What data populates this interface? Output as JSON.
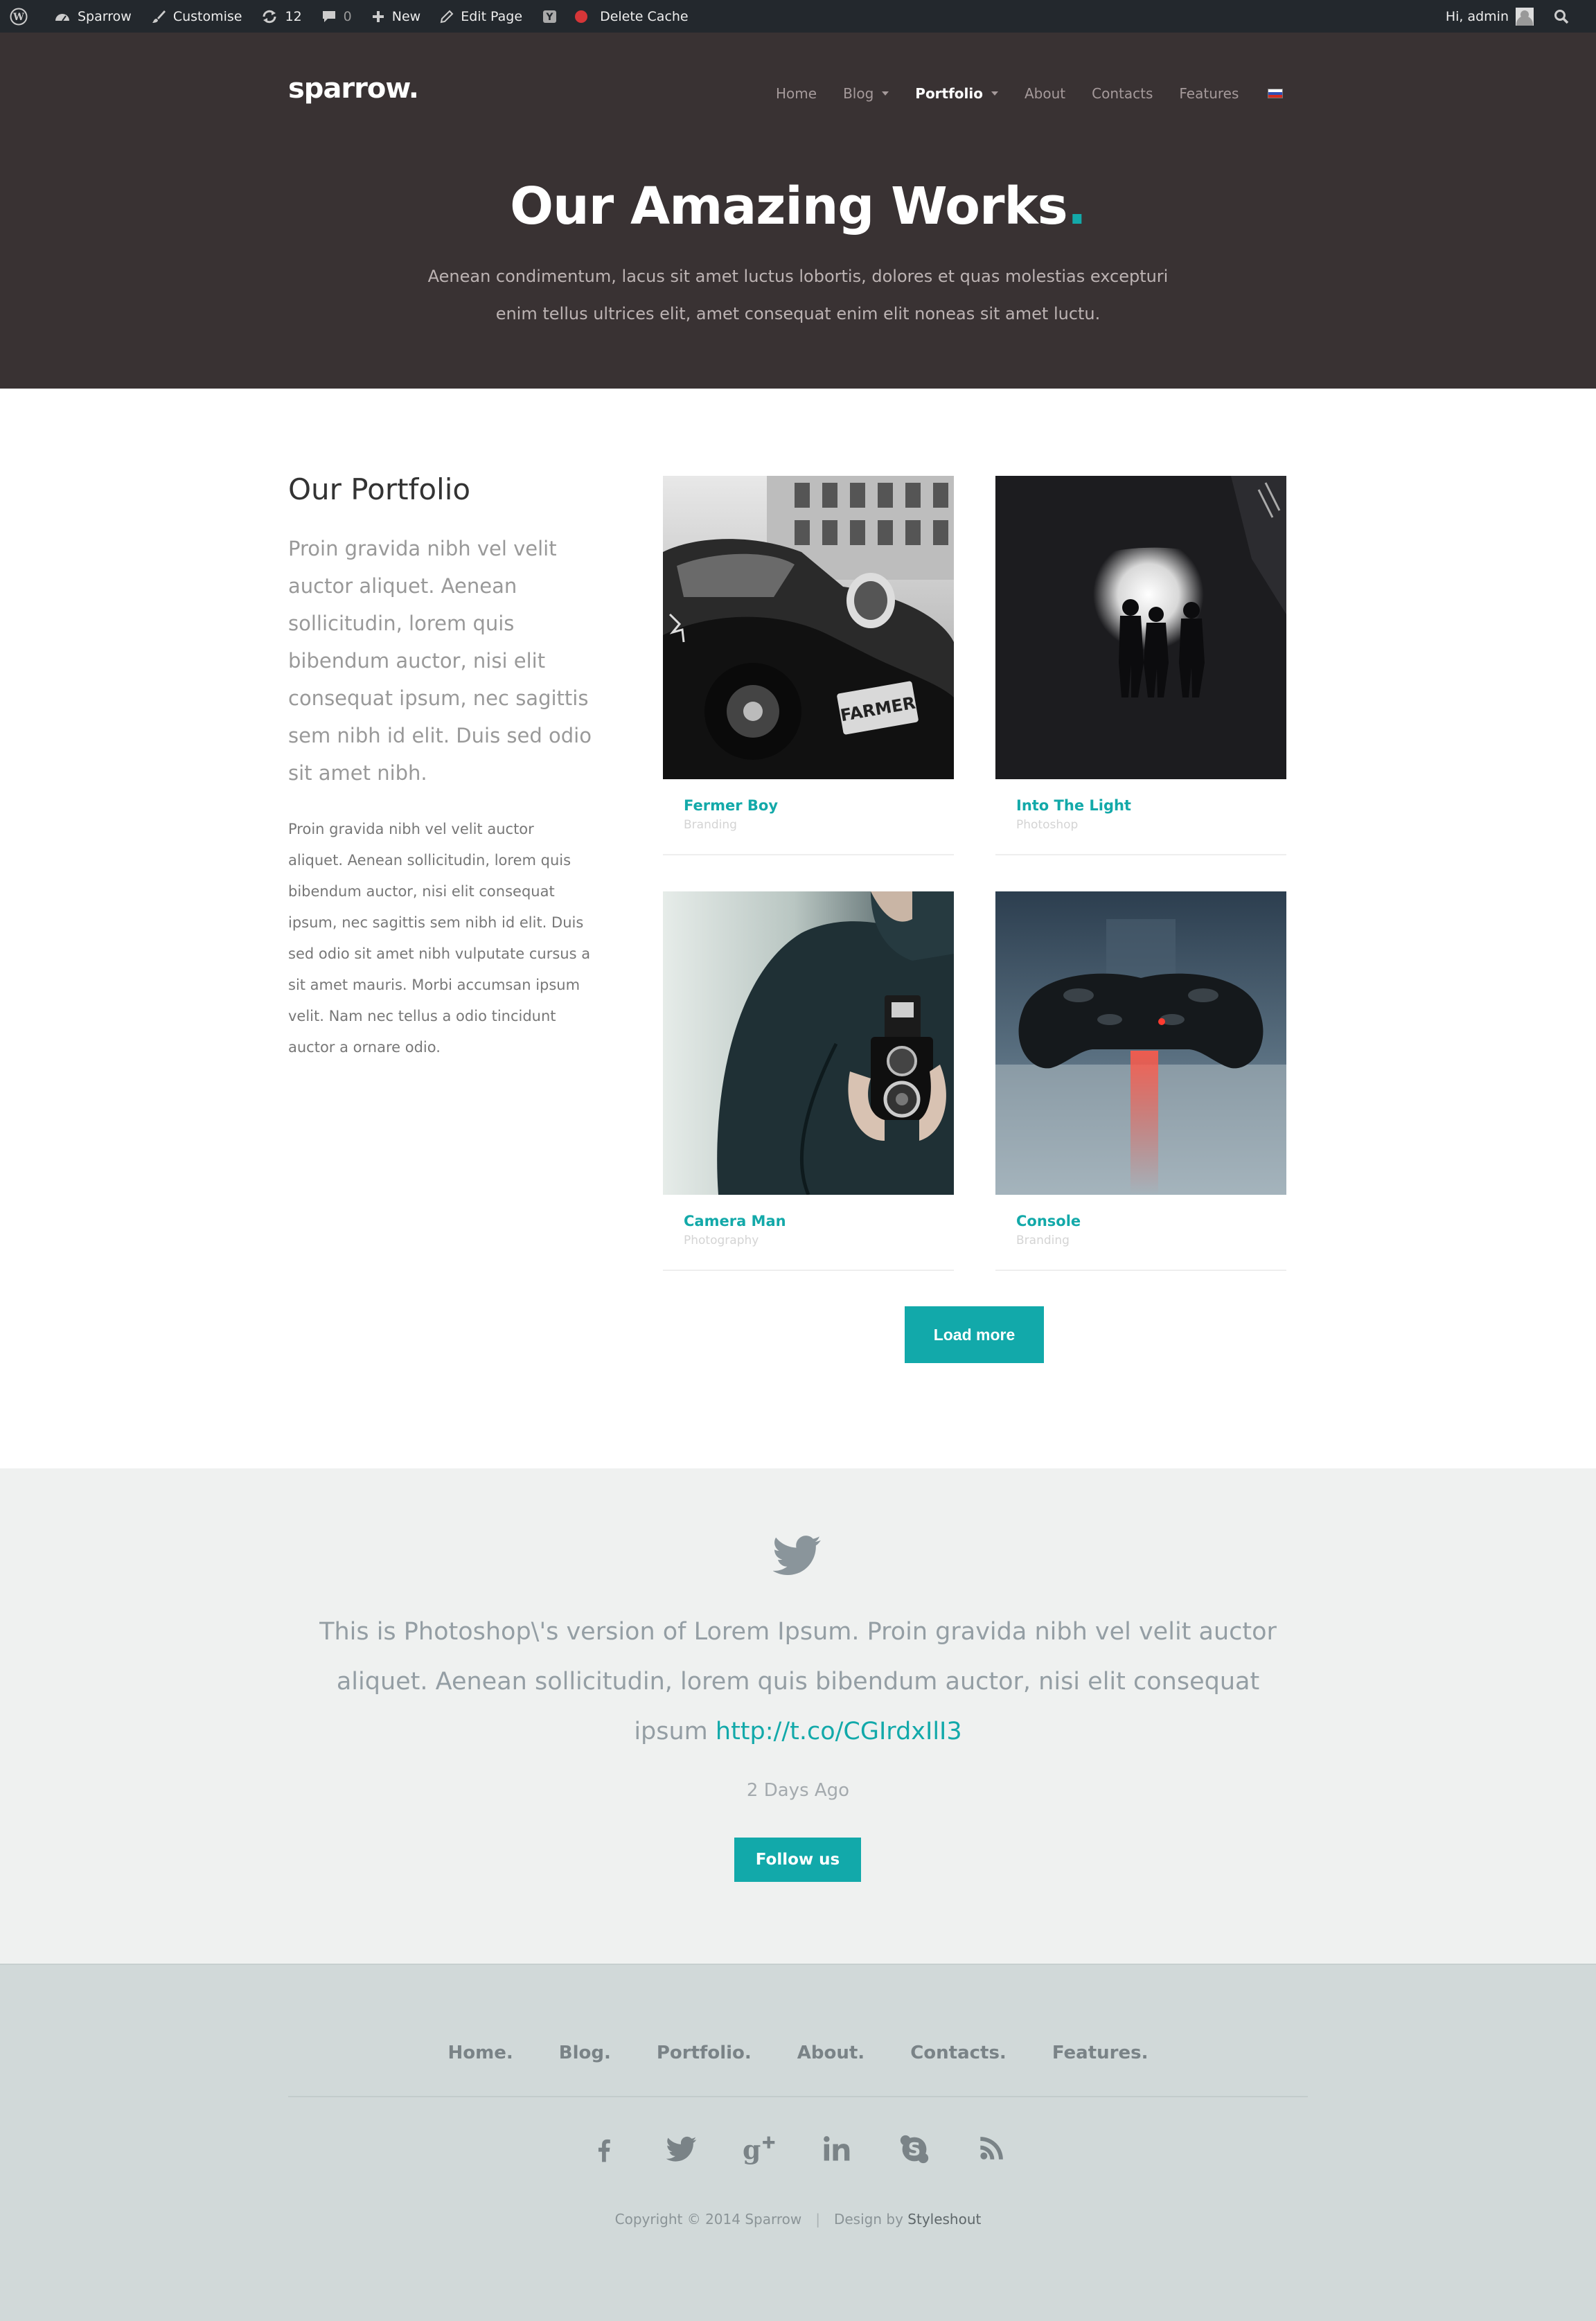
{
  "admin_bar": {
    "site_name": "Sparrow",
    "customise": "Customise",
    "updates": "12",
    "comments": "0",
    "new": "New",
    "edit_page": "Edit Page",
    "delete_cache": "Delete Cache",
    "greeting": "Hi, admin"
  },
  "header": {
    "logo": "sparrow.",
    "nav": [
      "Home",
      "Blog",
      "Portfolio",
      "About",
      "Contacts",
      "Features"
    ],
    "active_nav": "Portfolio"
  },
  "hero": {
    "title": "Our Amazing Works",
    "title_dot": ".",
    "subtitle": "Aenean condimentum, lacus sit amet luctus lobortis, dolores et quas molestias excepturi enim tellus ultrices elit, amet consequat enim elit noneas sit amet luctu."
  },
  "portfolio": {
    "heading": "Our Portfolio",
    "lead": "Proin gravida nibh vel velit auctor aliquet. Aenean sollicitudin, lorem quis bibendum auctor, nisi elit consequat ipsum, nec sagittis sem nibh id elit. Duis sed odio sit amet nibh.",
    "body": "Proin gravida nibh vel velit auctor aliquet. Aenean sollicitudin, lorem quis bibendum auctor, nisi elit consequat ipsum, nec sagittis sem nibh id elit. Duis sed odio sit amet nibh vulputate cursus a sit amet mauris. Morbi accumsan ipsum velit. Nam nec tellus a odio tincidunt auctor a ornare odio.",
    "items": [
      {
        "title": "Fermer Boy",
        "category": "Branding"
      },
      {
        "title": "Into The Light",
        "category": "Photoshop"
      },
      {
        "title": "Camera Man",
        "category": "Photography"
      },
      {
        "title": "Console",
        "category": "Branding"
      }
    ],
    "load_more": "Load more"
  },
  "twitter": {
    "tweet": "This is Photoshop\\'s version of Lorem Ipsum. Proin gravida nibh vel velit auctor aliquet. Aenean sollicitudin, lorem quis bibendum auctor, nisi elit consequat ipsum ",
    "link": "http://t.co/CGIrdxIlI3",
    "time": "2 Days Ago",
    "follow": "Follow us"
  },
  "footer": {
    "nav": [
      "Home.",
      "Blog.",
      "Portfolio.",
      "About.",
      "Contacts.",
      "Features."
    ],
    "social_icons": [
      "facebook-icon",
      "twitter-icon",
      "google-plus-icon",
      "linkedin-icon",
      "skype-icon",
      "rss-icon"
    ],
    "copyright": "Copyright © 2014 Sparrow",
    "separator": "|",
    "design_by": "Design by",
    "designer": "Styleshout"
  },
  "colors": {
    "accent": "#12a9aa",
    "hero_bg": "#393233",
    "admin_bar_bg": "#23282d",
    "twitter_bg": "#eff1f0",
    "footer_bg": "#d1d9d9"
  }
}
